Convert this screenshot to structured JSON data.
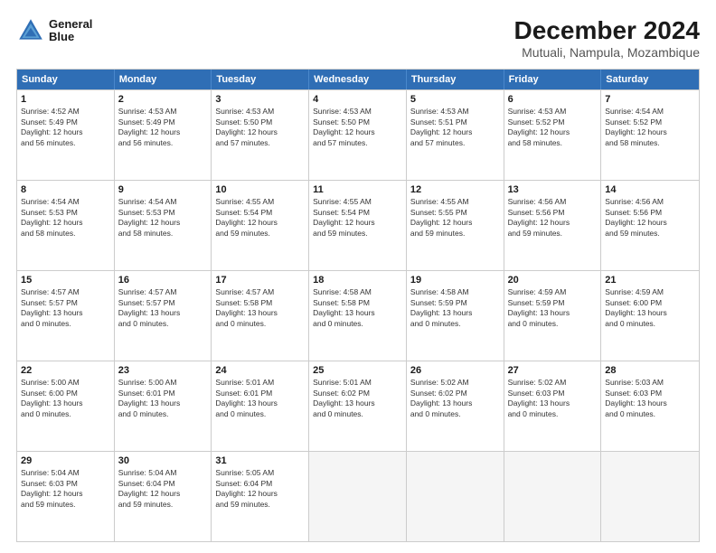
{
  "logo": {
    "line1": "General",
    "line2": "Blue"
  },
  "title": "December 2024",
  "subtitle": "Mutuali, Nampula, Mozambique",
  "header_days": [
    "Sunday",
    "Monday",
    "Tuesday",
    "Wednesday",
    "Thursday",
    "Friday",
    "Saturday"
  ],
  "rows": [
    [
      {
        "day": "1",
        "lines": [
          "Sunrise: 4:52 AM",
          "Sunset: 5:49 PM",
          "Daylight: 12 hours",
          "and 56 minutes."
        ]
      },
      {
        "day": "2",
        "lines": [
          "Sunrise: 4:53 AM",
          "Sunset: 5:49 PM",
          "Daylight: 12 hours",
          "and 56 minutes."
        ]
      },
      {
        "day": "3",
        "lines": [
          "Sunrise: 4:53 AM",
          "Sunset: 5:50 PM",
          "Daylight: 12 hours",
          "and 57 minutes."
        ]
      },
      {
        "day": "4",
        "lines": [
          "Sunrise: 4:53 AM",
          "Sunset: 5:50 PM",
          "Daylight: 12 hours",
          "and 57 minutes."
        ]
      },
      {
        "day": "5",
        "lines": [
          "Sunrise: 4:53 AM",
          "Sunset: 5:51 PM",
          "Daylight: 12 hours",
          "and 57 minutes."
        ]
      },
      {
        "day": "6",
        "lines": [
          "Sunrise: 4:53 AM",
          "Sunset: 5:52 PM",
          "Daylight: 12 hours",
          "and 58 minutes."
        ]
      },
      {
        "day": "7",
        "lines": [
          "Sunrise: 4:54 AM",
          "Sunset: 5:52 PM",
          "Daylight: 12 hours",
          "and 58 minutes."
        ]
      }
    ],
    [
      {
        "day": "8",
        "lines": [
          "Sunrise: 4:54 AM",
          "Sunset: 5:53 PM",
          "Daylight: 12 hours",
          "and 58 minutes."
        ]
      },
      {
        "day": "9",
        "lines": [
          "Sunrise: 4:54 AM",
          "Sunset: 5:53 PM",
          "Daylight: 12 hours",
          "and 58 minutes."
        ]
      },
      {
        "day": "10",
        "lines": [
          "Sunrise: 4:55 AM",
          "Sunset: 5:54 PM",
          "Daylight: 12 hours",
          "and 59 minutes."
        ]
      },
      {
        "day": "11",
        "lines": [
          "Sunrise: 4:55 AM",
          "Sunset: 5:54 PM",
          "Daylight: 12 hours",
          "and 59 minutes."
        ]
      },
      {
        "day": "12",
        "lines": [
          "Sunrise: 4:55 AM",
          "Sunset: 5:55 PM",
          "Daylight: 12 hours",
          "and 59 minutes."
        ]
      },
      {
        "day": "13",
        "lines": [
          "Sunrise: 4:56 AM",
          "Sunset: 5:56 PM",
          "Daylight: 12 hours",
          "and 59 minutes."
        ]
      },
      {
        "day": "14",
        "lines": [
          "Sunrise: 4:56 AM",
          "Sunset: 5:56 PM",
          "Daylight: 12 hours",
          "and 59 minutes."
        ]
      }
    ],
    [
      {
        "day": "15",
        "lines": [
          "Sunrise: 4:57 AM",
          "Sunset: 5:57 PM",
          "Daylight: 13 hours",
          "and 0 minutes."
        ]
      },
      {
        "day": "16",
        "lines": [
          "Sunrise: 4:57 AM",
          "Sunset: 5:57 PM",
          "Daylight: 13 hours",
          "and 0 minutes."
        ]
      },
      {
        "day": "17",
        "lines": [
          "Sunrise: 4:57 AM",
          "Sunset: 5:58 PM",
          "Daylight: 13 hours",
          "and 0 minutes."
        ]
      },
      {
        "day": "18",
        "lines": [
          "Sunrise: 4:58 AM",
          "Sunset: 5:58 PM",
          "Daylight: 13 hours",
          "and 0 minutes."
        ]
      },
      {
        "day": "19",
        "lines": [
          "Sunrise: 4:58 AM",
          "Sunset: 5:59 PM",
          "Daylight: 13 hours",
          "and 0 minutes."
        ]
      },
      {
        "day": "20",
        "lines": [
          "Sunrise: 4:59 AM",
          "Sunset: 5:59 PM",
          "Daylight: 13 hours",
          "and 0 minutes."
        ]
      },
      {
        "day": "21",
        "lines": [
          "Sunrise: 4:59 AM",
          "Sunset: 6:00 PM",
          "Daylight: 13 hours",
          "and 0 minutes."
        ]
      }
    ],
    [
      {
        "day": "22",
        "lines": [
          "Sunrise: 5:00 AM",
          "Sunset: 6:00 PM",
          "Daylight: 13 hours",
          "and 0 minutes."
        ]
      },
      {
        "day": "23",
        "lines": [
          "Sunrise: 5:00 AM",
          "Sunset: 6:01 PM",
          "Daylight: 13 hours",
          "and 0 minutes."
        ]
      },
      {
        "day": "24",
        "lines": [
          "Sunrise: 5:01 AM",
          "Sunset: 6:01 PM",
          "Daylight: 13 hours",
          "and 0 minutes."
        ]
      },
      {
        "day": "25",
        "lines": [
          "Sunrise: 5:01 AM",
          "Sunset: 6:02 PM",
          "Daylight: 13 hours",
          "and 0 minutes."
        ]
      },
      {
        "day": "26",
        "lines": [
          "Sunrise: 5:02 AM",
          "Sunset: 6:02 PM",
          "Daylight: 13 hours",
          "and 0 minutes."
        ]
      },
      {
        "day": "27",
        "lines": [
          "Sunrise: 5:02 AM",
          "Sunset: 6:03 PM",
          "Daylight: 13 hours",
          "and 0 minutes."
        ]
      },
      {
        "day": "28",
        "lines": [
          "Sunrise: 5:03 AM",
          "Sunset: 6:03 PM",
          "Daylight: 13 hours",
          "and 0 minutes."
        ]
      }
    ],
    [
      {
        "day": "29",
        "lines": [
          "Sunrise: 5:04 AM",
          "Sunset: 6:03 PM",
          "Daylight: 12 hours",
          "and 59 minutes."
        ]
      },
      {
        "day": "30",
        "lines": [
          "Sunrise: 5:04 AM",
          "Sunset: 6:04 PM",
          "Daylight: 12 hours",
          "and 59 minutes."
        ]
      },
      {
        "day": "31",
        "lines": [
          "Sunrise: 5:05 AM",
          "Sunset: 6:04 PM",
          "Daylight: 12 hours",
          "and 59 minutes."
        ]
      },
      {
        "day": "",
        "lines": []
      },
      {
        "day": "",
        "lines": []
      },
      {
        "day": "",
        "lines": []
      },
      {
        "day": "",
        "lines": []
      }
    ]
  ]
}
